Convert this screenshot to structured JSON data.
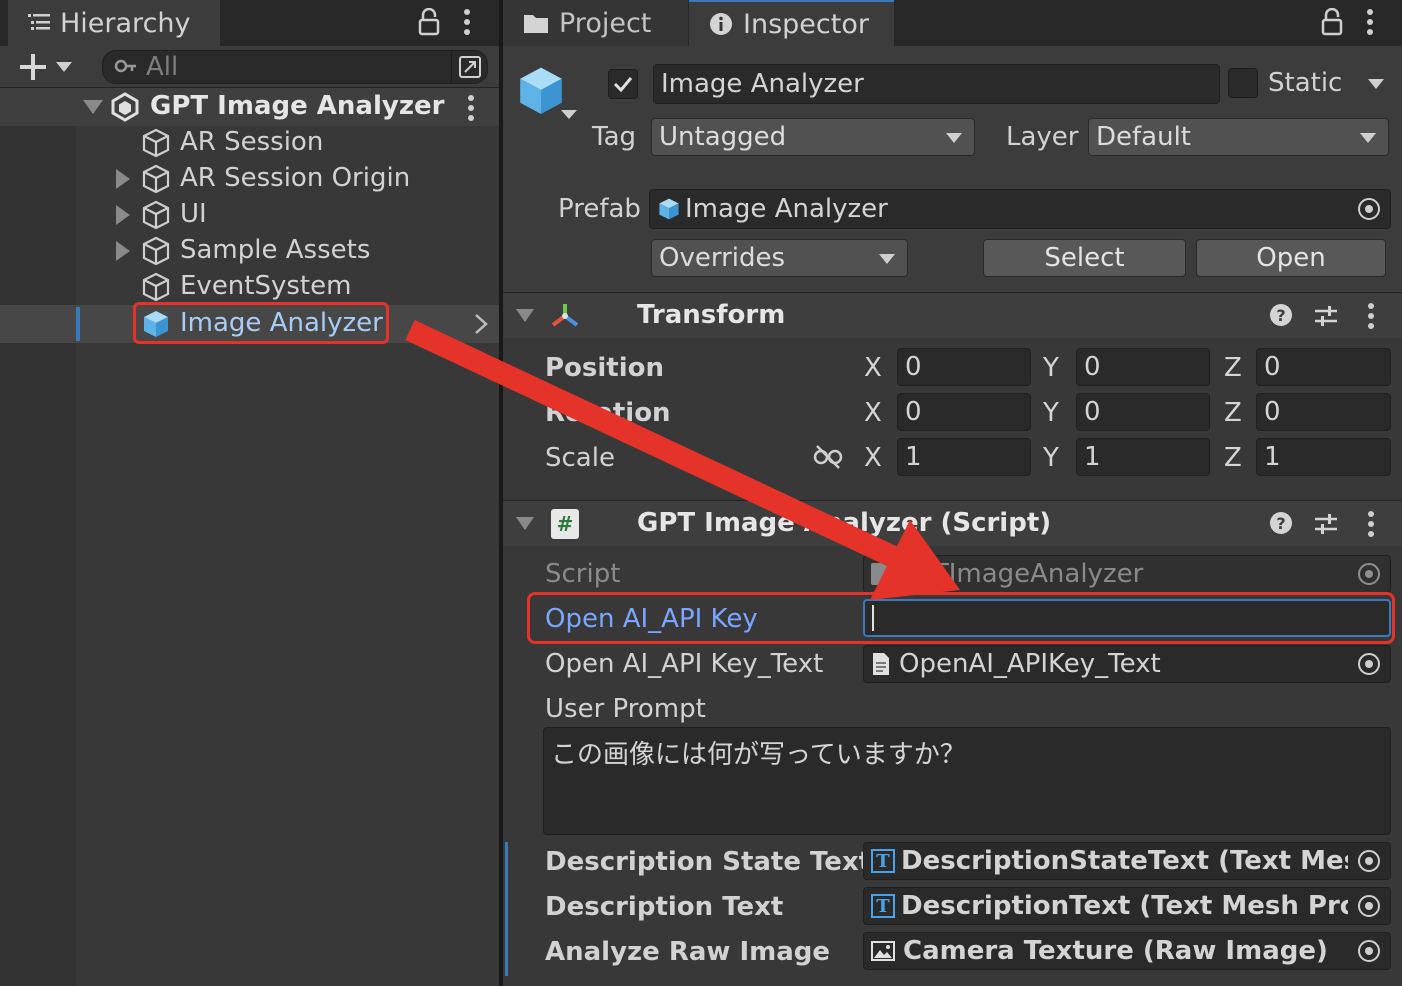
{
  "hierarchy": {
    "tab_label": "Hierarchy",
    "search_placeholder": "All",
    "root": "GPT Image Analyzer",
    "items": [
      {
        "label": "AR Session"
      },
      {
        "label": "AR Session Origin"
      },
      {
        "label": "UI"
      },
      {
        "label": "Sample Assets"
      },
      {
        "label": "EventSystem"
      },
      {
        "label": "Image Analyzer"
      }
    ]
  },
  "tabs": {
    "project": "Project",
    "inspector": "Inspector"
  },
  "header": {
    "object_name": "Image Analyzer",
    "static_label": "Static",
    "tag_label": "Tag",
    "tag_value": "Untagged",
    "layer_label": "Layer",
    "layer_value": "Default",
    "prefab_label": "Prefab",
    "prefab_value": "Image Analyzer",
    "overrides_label": "Overrides",
    "select_label": "Select",
    "open_label": "Open"
  },
  "transform": {
    "title": "Transform",
    "rows": [
      {
        "label": "Position",
        "x": "0",
        "y": "0",
        "z": "0"
      },
      {
        "label": "Rotation",
        "x": "0",
        "y": "0",
        "z": "0"
      },
      {
        "label": "Scale",
        "x": "1",
        "y": "1",
        "z": "1"
      }
    ],
    "axis_x": "X",
    "axis_y": "Y",
    "axis_z": "Z"
  },
  "script_component": {
    "title": "GPT Image Analyzer (Script)",
    "script_label": "Script",
    "script_value": "GPTImageAnalyzer",
    "api_key_label": "Open AI_API Key",
    "api_key_value": "",
    "api_key_text_label": "Open AI_API Key_Text",
    "api_key_text_value": "OpenAI_APIKey_Text",
    "user_prompt_label": "User Prompt",
    "user_prompt_value": "この画像には何が写っていますか？",
    "desc_state_label": "Description State Text",
    "desc_state_value": "DescriptionStateText (Text Mesh Pro UGUI)",
    "desc_text_label": "Description Text",
    "desc_text_value": "DescriptionText (Text Mesh Pro UGUI)",
    "raw_image_label": "Analyze Raw Image",
    "raw_image_value": "Camera Texture (Raw Image)"
  },
  "colors": {
    "highlight_red": "#e5332a",
    "selection_blue": "#7ba6ff",
    "accent_blue": "#3a79bb"
  }
}
